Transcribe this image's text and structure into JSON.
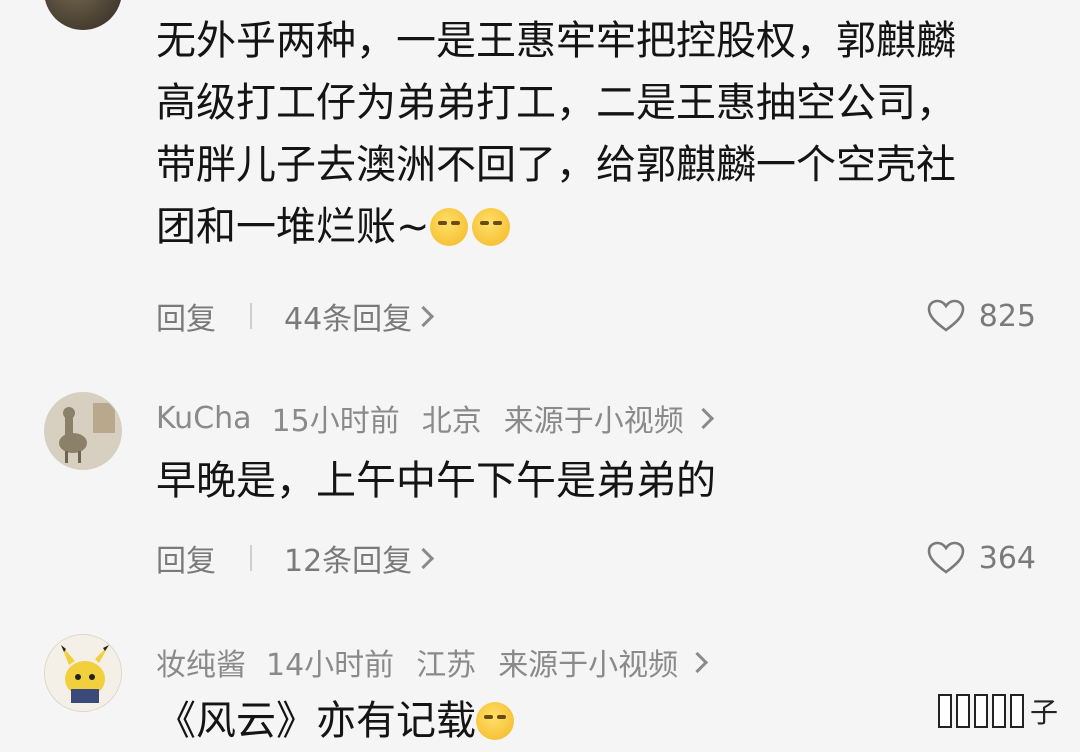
{
  "comments": [
    {
      "text_lines": [
        "无外乎两种，一是王惠牢牢把控股权，郭麒麟",
        "高级打工仔为弟弟打工，二是王惠抽空公司，",
        "带胖儿子去澳洲不回了，给郭麒麟一个空壳社",
        "团和一堆烂账~"
      ],
      "reply_label": "回复",
      "replies_label": "44条回复",
      "like_count": "825"
    },
    {
      "username": "KuCha",
      "time": "15小时前",
      "location": "北京",
      "source": "来源于小视频",
      "text": "早晚是，上午中午下午是弟弟的",
      "reply_label": "回复",
      "replies_label": "12条回复",
      "like_count": "364"
    },
    {
      "username": "妆纯酱",
      "time": "14小时前",
      "location": "江苏",
      "source": "来源于小视频",
      "text": "《风云》亦有记载"
    }
  ],
  "watermark": "子",
  "icons": {
    "heart": "heart-icon",
    "chevron": "chevron-right-icon",
    "emoji": "smirk-emoji"
  }
}
